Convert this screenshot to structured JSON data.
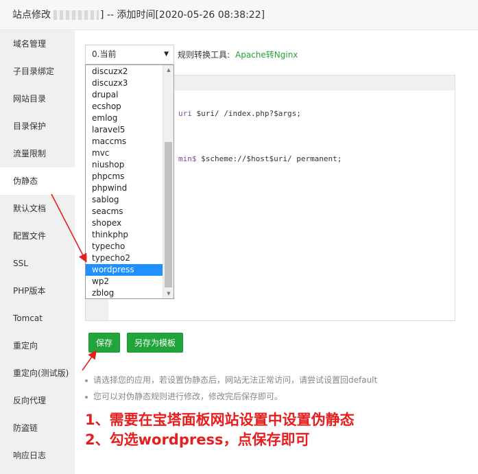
{
  "title": {
    "prefix": "站点修改",
    "suffix": "] -- 添加时间[2020-05-26 08:38:22]"
  },
  "sidebar": {
    "items": [
      {
        "label": "域名管理"
      },
      {
        "label": "子目录绑定"
      },
      {
        "label": "网站目录"
      },
      {
        "label": "目录保护"
      },
      {
        "label": "流量限制"
      },
      {
        "label": "伪静态",
        "active": true
      },
      {
        "label": "默认文档"
      },
      {
        "label": "配置文件"
      },
      {
        "label": "SSL"
      },
      {
        "label": "PHP版本"
      },
      {
        "label": "Tomcat"
      },
      {
        "label": "重定向"
      },
      {
        "label": "重定向(测试版)"
      },
      {
        "label": "反向代理"
      },
      {
        "label": "防盗链"
      },
      {
        "label": "响应日志"
      }
    ]
  },
  "rewrite": {
    "selected_value": "0.当前",
    "tool_label": "规则转换工具:",
    "tool_link": "Apache转Nginx",
    "options": [
      "discuzx2",
      "discuzx3",
      "drupal",
      "ecshop",
      "emlog",
      "laravel5",
      "maccms",
      "mvc",
      "niushop",
      "phpcms",
      "phpwind",
      "sablog",
      "seacms",
      "shopex",
      "thinkphp",
      "typecho",
      "typecho2",
      "wordpress",
      "wp2",
      "zblog"
    ],
    "highlighted_option": "wordpress"
  },
  "editor": {
    "line1_kw": "uri",
    "line1_rest": " $uri/ /index.php?$args;",
    "line2_kw": "min$",
    "line2_rest": " $scheme://$host$uri/ permanent;"
  },
  "buttons": {
    "save": "保存",
    "save_template": "另存为模板"
  },
  "tips": [
    "请选择您的应用，若设置伪静态后，网站无法正常访问，请尝试设置回default",
    "您可以对伪静态规则进行修改，修改完后保存即可。"
  ],
  "notes": [
    "1、需要在宝塔面板网站设置中设置伪静态",
    "2、勾选wordpress，点保存即可"
  ],
  "colors": {
    "accent": "#20a53a",
    "selection": "#1e90ff",
    "annotation": "#e81e1e"
  }
}
